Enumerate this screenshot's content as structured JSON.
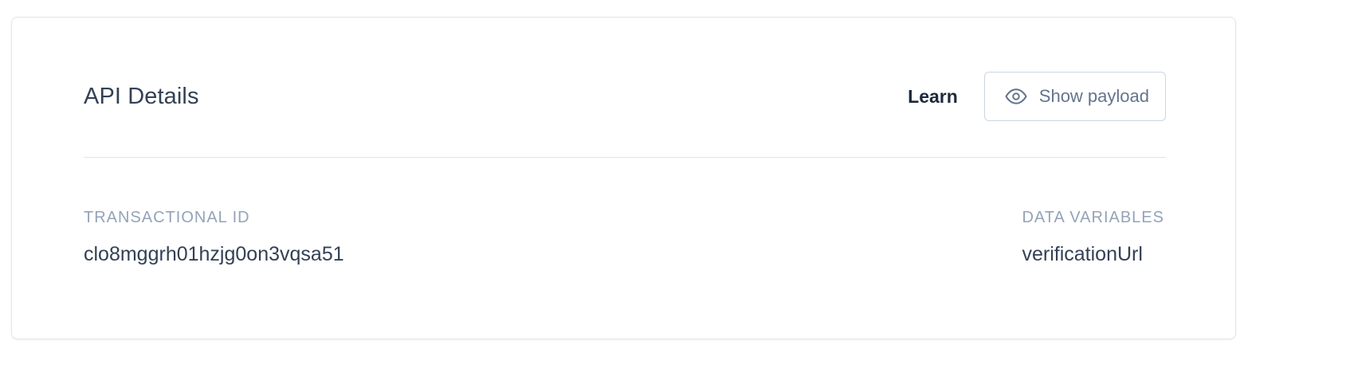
{
  "card": {
    "title": "API Details",
    "learn_label": "Learn",
    "show_payload_label": "Show payload",
    "show_payload_icon": "eye-icon"
  },
  "fields": {
    "transactional_id": {
      "label": "TRANSACTIONAL ID",
      "value": "clo8mggrh01hzjg0on3vqsa51"
    },
    "data_variables": {
      "label": "DATA VARIABLES",
      "value": "verificationUrl"
    }
  }
}
